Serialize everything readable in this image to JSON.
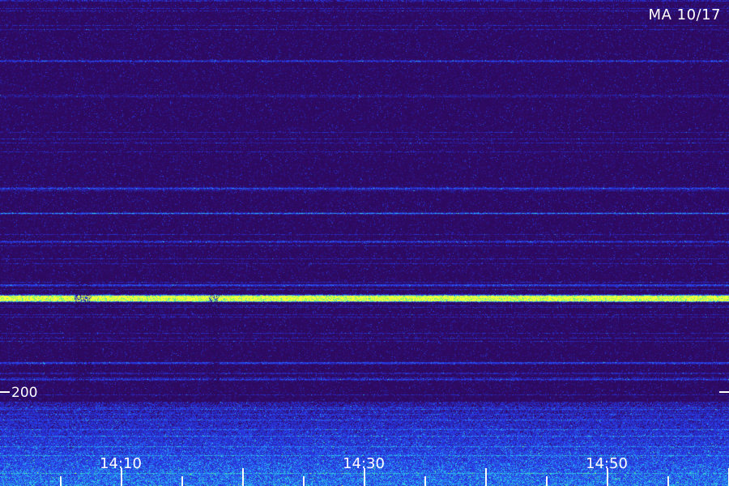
{
  "chart_data": {
    "type": "heatmap",
    "title": "MA 10/17",
    "colors": {
      "background": "#2a0d5c",
      "mid": "#2f3fe6",
      "high": "#3fd0ff",
      "peak": "#f0ff3a"
    },
    "y_axis": {
      "ticks": [
        {
          "value": 200,
          "label": "200"
        }
      ]
    },
    "x_axis": {
      "labels": [
        "14:10",
        "14:30",
        "14:50"
      ],
      "minor_tick_count": 12
    }
  }
}
